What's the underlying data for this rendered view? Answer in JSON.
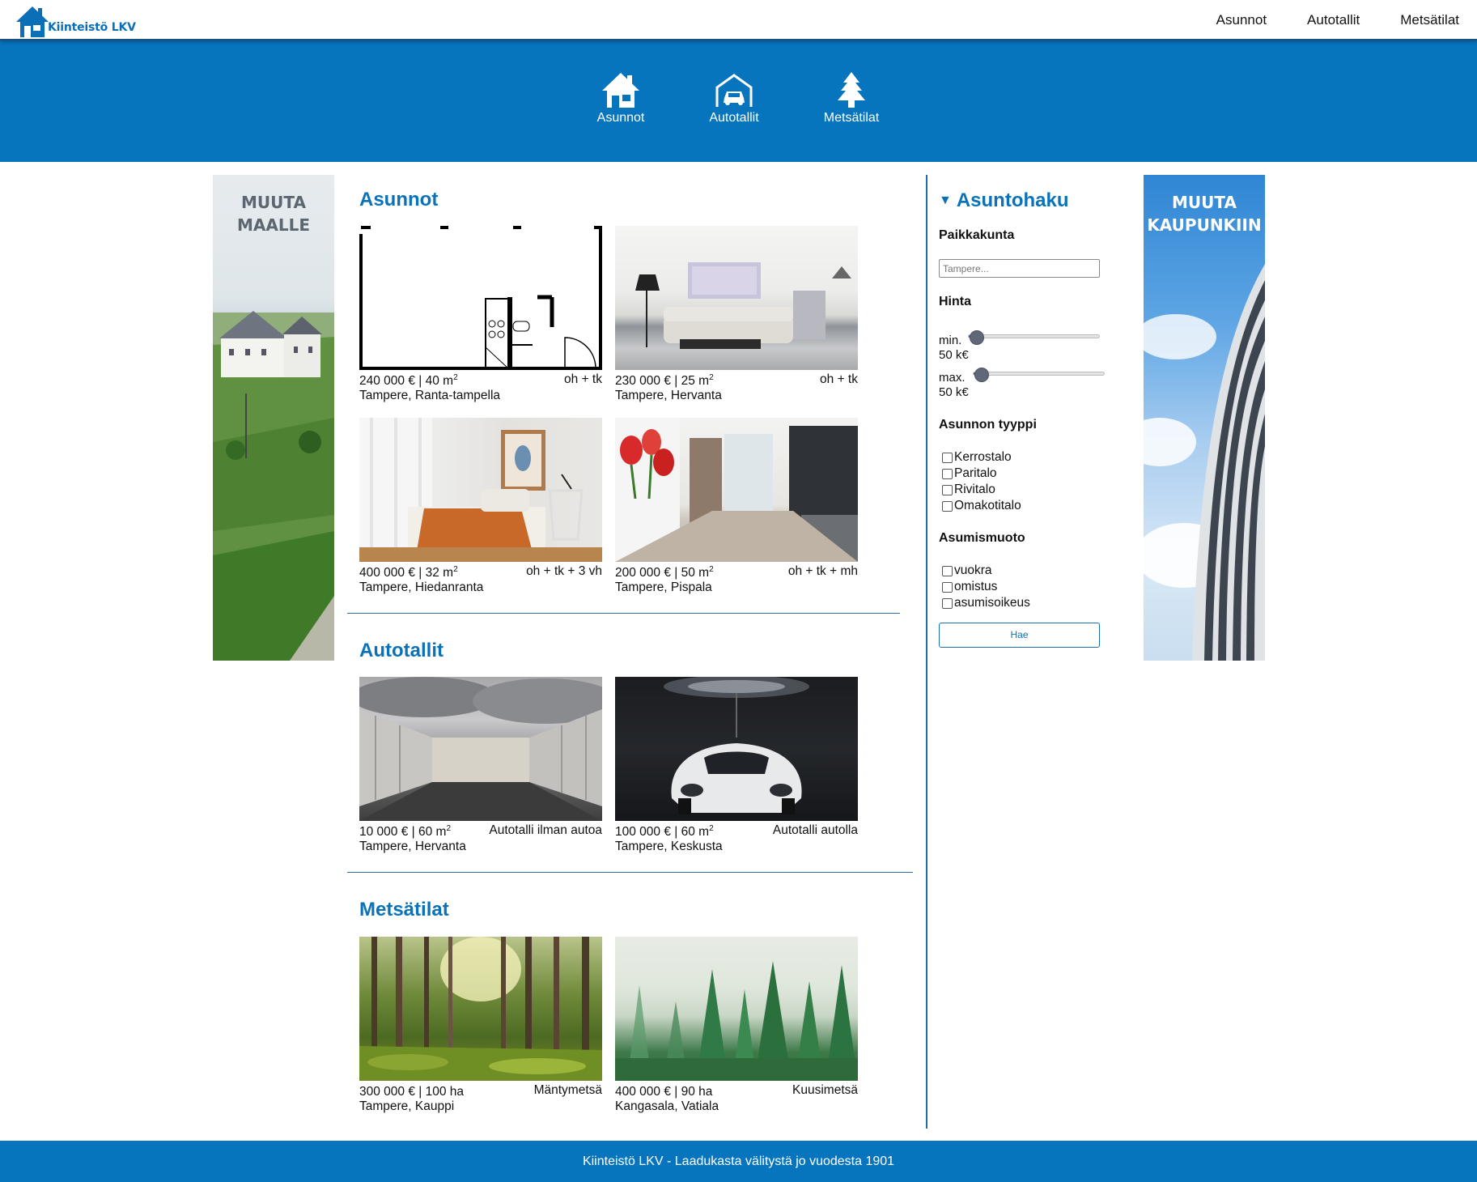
{
  "header": {
    "logo_text": "Kiinteistö LKV",
    "nav": [
      {
        "label": "Asunnot"
      },
      {
        "label": "Autotallit"
      },
      {
        "label": "Metsätilat"
      }
    ]
  },
  "hero": {
    "items": [
      {
        "label": "Asunnot",
        "icon": "house-icon"
      },
      {
        "label": "Autotallit",
        "icon": "garage-icon"
      },
      {
        "label": "Metsätilat",
        "icon": "tree-icon"
      }
    ]
  },
  "banners": {
    "left": {
      "line1": "MUUTA",
      "line2": "MAALLE"
    },
    "right": {
      "line1": "MUUTA",
      "line2": "KAUPUNKIIN"
    }
  },
  "sections": {
    "asunnot": {
      "title": "Asunnot",
      "cards": [
        {
          "price": "240 000 € | 40 m",
          "loc": "Tampere, Ranta-tampella",
          "kind": "oh + tk"
        },
        {
          "price": "230 000 € | 25 m",
          "loc": "Tampere, Hervanta",
          "kind": "oh + tk"
        },
        {
          "price": "400 000 € | 32 m",
          "loc": "Tampere, Hiedanranta",
          "kind": "oh + tk + 3 vh"
        },
        {
          "price": "200 000 € | 50 m",
          "loc": "Tampere, Pispala",
          "kind": "oh + tk + mh"
        }
      ]
    },
    "autotallit": {
      "title": "Autotallit",
      "cards": [
        {
          "price": "10 000 € | 60 m",
          "loc": "Tampere, Hervanta",
          "kind": "Autotalli ilman autoa"
        },
        {
          "price": "100 000 € | 60 m",
          "loc": "Tampere, Keskusta",
          "kind": "Autotalli autolla"
        }
      ]
    },
    "metsatilat": {
      "title": "Metsätilat",
      "cards": [
        {
          "price": "300 000 € | 100 ha",
          "loc": "Tampere, Kauppi",
          "kind": "Mäntymetsä"
        },
        {
          "price": "400 000 € | 90 ha",
          "loc": "Kangasala, Vatiala",
          "kind": "Kuusimetsä"
        }
      ]
    },
    "area_unit_sup": "2"
  },
  "search": {
    "title": "Asuntohaku",
    "paikkakunta_label": "Paikkakunta",
    "paikkakunta_placeholder": "Tampere...",
    "hinta_label": "Hinta",
    "min_label": "min.",
    "min_value": "50 k€",
    "min_slider_level": 0.06,
    "max_label": "max.",
    "max_value": "50 k€",
    "max_slider_level": 0.06,
    "tyyppi_label": "Asunnon tyyppi",
    "tyyppi_options": [
      "Kerrostalo",
      "Paritalo",
      "Rivitalo",
      "Omakotitalo"
    ],
    "muoto_label": "Asumismuoto",
    "muoto_options": [
      "vuokra",
      "omistus",
      "asumisoikeus"
    ],
    "submit_label": "Hae"
  },
  "footer": {
    "text": "Kiinteistö LKV - Laadukasta välitystä jo vuodesta 1901"
  },
  "colors": {
    "brand_blue": "#0774be",
    "heading_blue": "#0a72b9"
  }
}
